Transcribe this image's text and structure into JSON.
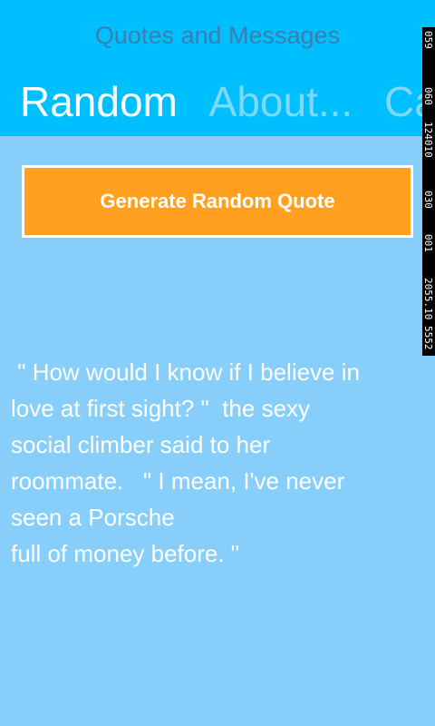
{
  "app": {
    "title": "Quotes and Messages"
  },
  "pivot": {
    "items": [
      {
        "label": "Random",
        "active": true
      },
      {
        "label": "About...",
        "active": false
      },
      {
        "label": "Ca",
        "active": false
      }
    ]
  },
  "debug_counters": [
    "059",
    "060",
    "124010",
    "030",
    "001",
    "2055.10 5552"
  ],
  "main": {
    "button_label": "Generate Random Quote",
    "quote_text": " \" How would I know if I believe in\nlove at first sight? \"  the sexy\nsocial climber said to her\nroommate.   \" I mean, I've never\nseen a Porsche\nfull of money before. \""
  },
  "colors": {
    "header_bg": "#00BFFF",
    "page_bg": "#87CEFA",
    "button_bg": "#FFA020",
    "title_text": "#3A7FB0",
    "inactive_tab": "#7FD8F7"
  }
}
